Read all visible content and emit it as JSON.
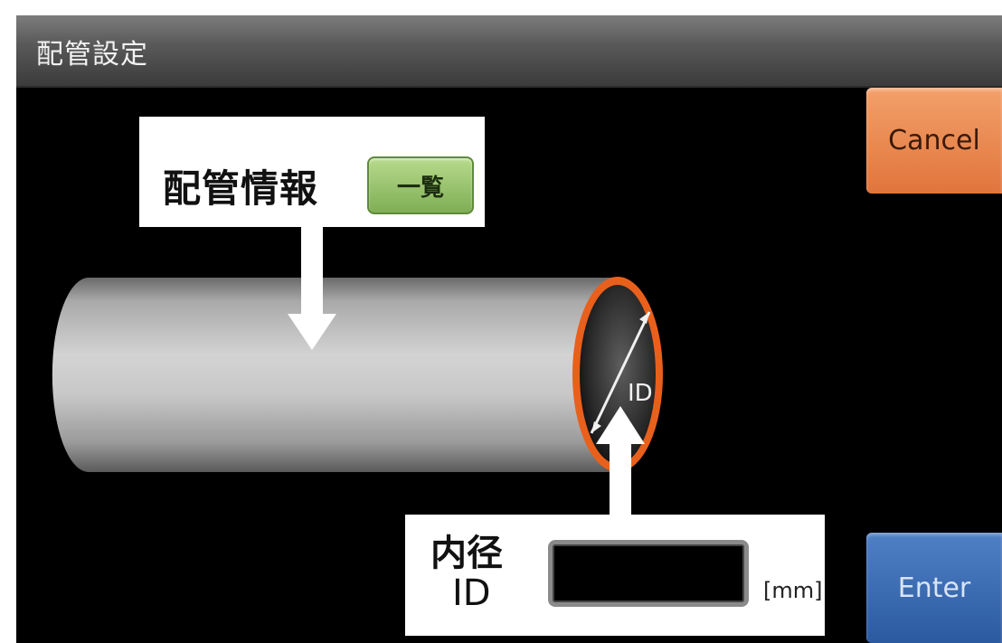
{
  "window": {
    "title": "配管設定"
  },
  "pipe_info": {
    "label": "配管情報",
    "list_button_label": "一覧"
  },
  "inner_diameter": {
    "label_ja": "内径",
    "label_en": "ID",
    "value": "",
    "unit": "[mm]"
  },
  "pipe_diagram": {
    "end_label": "ID"
  },
  "buttons": {
    "cancel_label": "Cancel",
    "enter_label": "Enter"
  },
  "colors": {
    "pipe_end_ring": "#e8601c",
    "cancel": "#ea8a52",
    "enter": "#3b6cb4",
    "list_button": "#9cc873"
  }
}
